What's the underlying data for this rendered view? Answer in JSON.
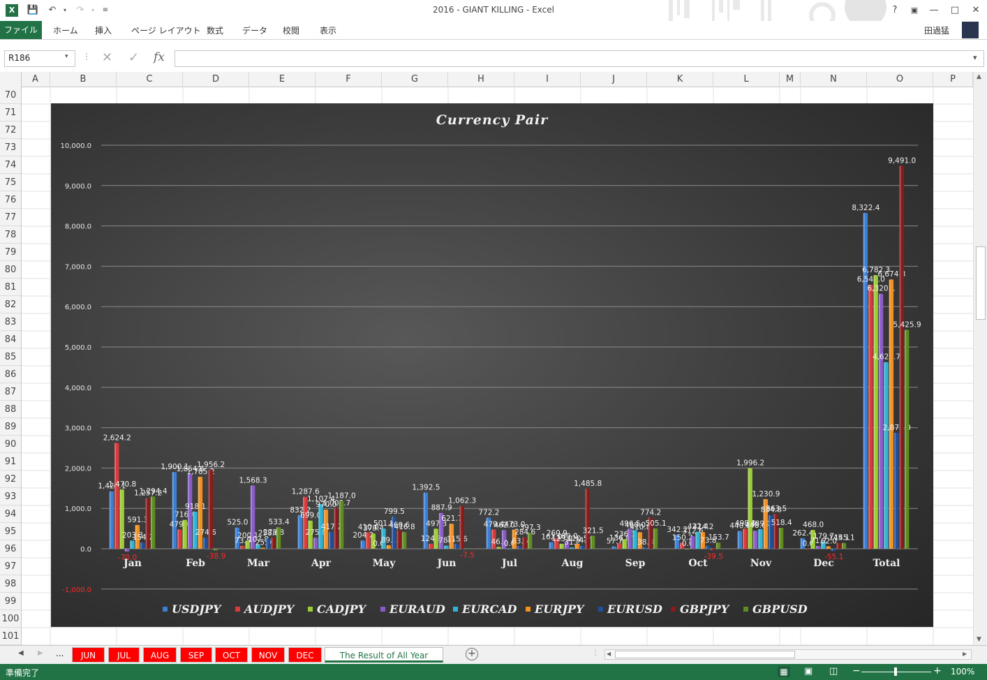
{
  "window": {
    "title": "2016 - GIANT KILLING - Excel",
    "user": "田過猛",
    "help": "?"
  },
  "ribbon": {
    "file": "ファイル",
    "tabs": [
      "ホーム",
      "挿入",
      "ページ レイアウト",
      "数式",
      "データ",
      "校閲",
      "表示"
    ]
  },
  "formula_bar": {
    "name_box": "R186",
    "fx": "fx",
    "value": ""
  },
  "columns": [
    "A",
    "B",
    "C",
    "D",
    "E",
    "F",
    "G",
    "H",
    "I",
    "J",
    "K",
    "L",
    "M",
    "N",
    "O",
    "P"
  ],
  "rows": [
    "70",
    "71",
    "72",
    "73",
    "74",
    "75",
    "76",
    "77",
    "78",
    "79",
    "80",
    "81",
    "82",
    "83",
    "84",
    "85",
    "86",
    "87",
    "88",
    "89",
    "90",
    "91",
    "92",
    "93",
    "94",
    "95",
    "96",
    "97",
    "98",
    "99",
    "100",
    "101"
  ],
  "sheet_tabs": {
    "ellipsis": "...",
    "tabs": [
      "JUN",
      "JUL",
      "AUG",
      "SEP",
      "OCT",
      "NOV",
      "DEC",
      "The Result of All Year"
    ],
    "active": "The Result of All Year"
  },
  "status": {
    "text": "準備完了",
    "zoom": "100%"
  },
  "colors": {
    "excel_green": "#217346",
    "tab_red": "#ff0000",
    "series": [
      "#3a7fd6",
      "#d93a3a",
      "#9ccc33",
      "#8a5cc9",
      "#2fb4d6",
      "#f29022",
      "#1f4e9c",
      "#8b1a1a",
      "#5e8c1e"
    ]
  },
  "chart_data": {
    "type": "bar",
    "title": "Currency Pair",
    "ylim": [
      -1000,
      10000
    ],
    "yticks": [
      "-1,000.0",
      "0.0",
      "1,000.0",
      "2,000.0",
      "3,000.0",
      "4,000.0",
      "5,000.0",
      "6,000.0",
      "7,000.0",
      "8,000.0",
      "9,000.0",
      "10,000.0"
    ],
    "ytick_values": [
      -1000,
      0,
      1000,
      2000,
      3000,
      4000,
      5000,
      6000,
      7000,
      8000,
      9000,
      10000
    ],
    "grid": true,
    "legend": "bottom",
    "categories": [
      "Jan",
      "Feb",
      "Mar",
      "Apr",
      "May",
      "Jun",
      "Jul",
      "Aug",
      "Sep",
      "Oct",
      "Nov",
      "Dec",
      "Total"
    ],
    "series": [
      {
        "name": "USDJPY",
        "values": [
          1423.1,
          1900.1,
          525.0,
          832.2,
          204.2,
          1392.5,
          772.2,
          162.0,
          57.7,
          342.2,
          440.8,
          262.4,
          8322.4
        ],
        "labels": [
          "1,423.1",
          "1,900.1",
          "525.0",
          "832.2",
          "204.2",
          "1,392.5",
          "772.2",
          "162.0",
          "57.7",
          "342.2",
          "440.8",
          "262.4",
          "8,322.4"
        ]
      },
      {
        "name": "AUDJPY",
        "values": [
          2624.2,
          479.4,
          73.5,
          1287.6,
          410.0,
          124.9,
          479.4,
          260.9,
          136.8,
          150.2,
          498.0,
          0.0,
          6545.0
        ],
        "labels": [
          "2,624.2",
          "479.4",
          "73.5",
          "1,287.6",
          "410.0",
          "124.9",
          "479.4",
          "260.9",
          "136.8",
          "150.2",
          "498.0",
          "0.0",
          "6,545.0"
        ]
      },
      {
        "name": "CADJPY",
        "values": [
          1470.8,
          716.4,
          200.1,
          699.0,
          379.4,
          497.3,
          46.2,
          123.0,
          236.1,
          0.0,
          1996.2,
          468.0,
          6782.3
        ],
        "labels": [
          "1,470.8",
          "716.4",
          "200.1",
          "699.0",
          "379.4",
          "497.3",
          "46.2",
          "123.0",
          "236.1",
          "0.0",
          "1,996.2",
          "468.0",
          "6,782.3"
        ]
      },
      {
        "name": "EURAUD",
        "values": [
          -70.0,
          1854.6,
          1568.3,
          275.6,
          0.0,
          887.9,
          462.0,
          180.0,
          496.5,
          312.6,
          448.0,
          71.2,
          6320.1
        ],
        "labels": [
          "-70.0",
          "1,854.6",
          "1,568.3",
          "275.6",
          "0.0",
          "887.9",
          "462.0",
          "180.0",
          "496.5",
          "312.6",
          "448.0",
          "71.2",
          "6,320.1"
        ]
      },
      {
        "name": "EURCAD",
        "values": [
          203.3,
          918.1,
          107.8,
          1107.4,
          501.8,
          78.0,
          0.0,
          31.2,
          460.0,
          422.4,
          489.0,
          179.7,
          4625.7
        ],
        "labels": [
          "203.3",
          "918.1",
          "107.8",
          "1,107.4",
          "501.8",
          "78.0",
          "0.0",
          "31.2",
          "460.0",
          "422.4",
          "489.0",
          "179.7",
          "4,625.7"
        ]
      },
      {
        "name": "EURJPY",
        "values": [
          591.3,
          1785.2,
          25.0,
          970.0,
          89.1,
          621.7,
          473.0,
          120.5,
          410.8,
          414.2,
          1230.9,
          62.0,
          6674.3
        ],
        "labels": [
          "591.3",
          "1,785.2",
          "25.0",
          "970.0",
          "89.1",
          "621.7",
          "473.0",
          "120.5",
          "410.8",
          "414.2",
          "1,230.9",
          "62.0",
          "6,674.3"
        ]
      },
      {
        "name": "EURUSD",
        "values": [
          154.2,
          274.6,
          258.0,
          417.2,
          799.5,
          115.6,
          63.5,
          74.7,
          38.3,
          73.8,
          834.8,
          -55.1,
          2875.0
        ],
        "labels": [
          "154.2",
          "274.6",
          "258.0",
          "417.2",
          "799.5",
          "115.6",
          "63.5",
          "74.7",
          "38.3",
          "73.8",
          "834.8",
          "-55.1",
          "2,875.0"
        ]
      },
      {
        "name": "GBPJPY",
        "values": [
          1257.2,
          1956.2,
          278.8,
          1003.7,
          460.6,
          1062.3,
          284.6,
          1485.8,
          774.2,
          -39.5,
          863.5,
          145.1,
          9491.0
        ],
        "labels": [
          "1,257.2",
          "1,956.2",
          "278.8",
          "1,003.7",
          "460.6",
          "1,062.3",
          "284.6",
          "1,485.8",
          "774.2",
          "-39.5",
          "863.5",
          "145.1",
          "9,491.0"
        ]
      },
      {
        "name": "GBPUSD",
        "values": [
          1294.4,
          -38.9,
          533.4,
          1187.0,
          416.8,
          -7.5,
          397.3,
          321.5,
          505.1,
          153.7,
          518.4,
          145.1,
          5425.9
        ],
        "labels": [
          "1,294.4",
          "-38.9",
          "533.4",
          "1,187.0",
          "416.8",
          "-7.5",
          "397.3",
          "321.5",
          "505.1",
          "153.7",
          "518.4",
          "145.1",
          "5,425.9"
        ]
      }
    ]
  }
}
